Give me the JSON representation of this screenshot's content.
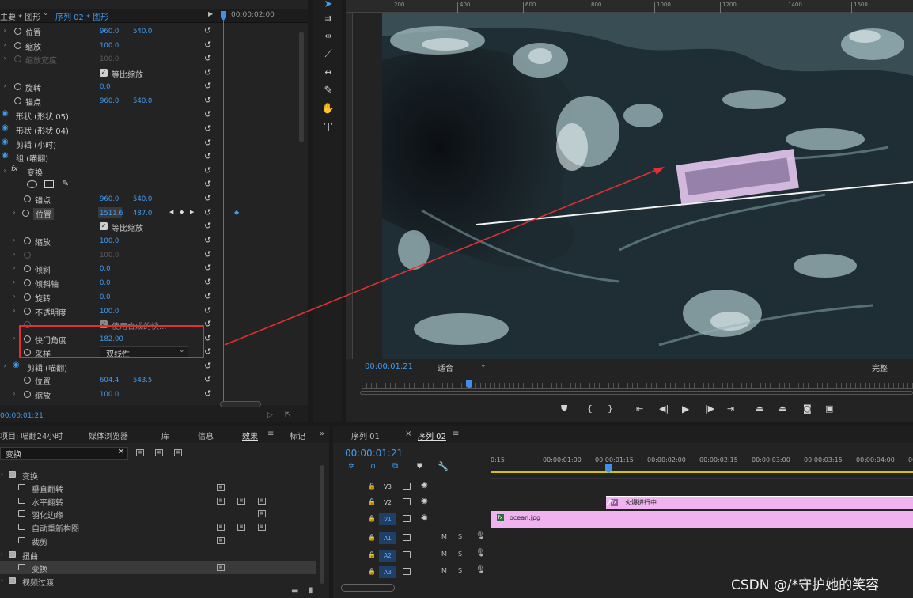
{
  "effect_controls": {
    "source_tab": "主要 * 图形",
    "sequence_tab": "序列 02 * 图形",
    "timecode_header": "00:00:02:00",
    "current_time": "00:00:01:21",
    "rows": [
      {
        "label": "位置",
        "v1": "960.0",
        "v2": "540.0"
      },
      {
        "label": "缩放",
        "v1": "100.0",
        "v2": ""
      },
      {
        "label": "缩放宽度",
        "v1": "100.0",
        "v2": ""
      },
      {
        "label": "等比缩放",
        "v1": "",
        "v2": ""
      },
      {
        "label": "旋转",
        "v1": "0.0",
        "v2": ""
      },
      {
        "label": "锚点",
        "v1": "960.0",
        "v2": "540.0"
      },
      {
        "label": "形状 (形状 05)",
        "v1": "",
        "v2": ""
      },
      {
        "label": "形状 (形状 04)",
        "v1": "",
        "v2": ""
      },
      {
        "label": "剪辑 (小时)",
        "v1": "",
        "v2": ""
      },
      {
        "label": "组 (喵翻)",
        "v1": "",
        "v2": ""
      },
      {
        "label": "变换",
        "v1": "",
        "v2": ""
      },
      {
        "label": "",
        "v1": "",
        "v2": ""
      },
      {
        "label": "锚点",
        "v1": "960.0",
        "v2": "540.0"
      },
      {
        "label": "位置",
        "v1": "1511.6",
        "v2": "487.0"
      },
      {
        "label": "等比缩放",
        "v1": "",
        "v2": ""
      },
      {
        "label": "缩放",
        "v1": "100.0",
        "v2": ""
      },
      {
        "label": "",
        "v1": "100.0",
        "v2": ""
      },
      {
        "label": "倾斜",
        "v1": "0.0",
        "v2": ""
      },
      {
        "label": "倾斜轴",
        "v1": "0.0",
        "v2": ""
      },
      {
        "label": "旋转",
        "v1": "0.0",
        "v2": ""
      },
      {
        "label": "不透明度",
        "v1": "100.0",
        "v2": ""
      },
      {
        "label": "使用合成的快...",
        "v1": "",
        "v2": ""
      },
      {
        "label": "快门角度",
        "v1": "182.00",
        "v2": ""
      },
      {
        "label": "采样",
        "v1": "",
        "v2": ""
      },
      {
        "label": "剪辑 (喵翻)",
        "v1": "",
        "v2": ""
      },
      {
        "label": "位置",
        "v1": "604.4",
        "v2": "543.5"
      },
      {
        "label": "缩放",
        "v1": "100.0",
        "v2": ""
      }
    ],
    "sampling_value": "双线性"
  },
  "program": {
    "timecode": "00:00:01:21",
    "fit": "适合",
    "quality": "完整",
    "ruler_ticks": [
      "200",
      "400",
      "600",
      "800",
      "1000",
      "1200",
      "1400",
      "1600"
    ]
  },
  "effects_panel": {
    "tabs": [
      "项目: 喵翻24小时",
      "媒体浏览器",
      "库",
      "信息",
      "效果",
      "标记"
    ],
    "search_value": "变换",
    "items": [
      {
        "label": "变换"
      },
      {
        "label": "垂直翻转"
      },
      {
        "label": "水平翻转"
      },
      {
        "label": "羽化边缘"
      },
      {
        "label": "自动重新构图"
      },
      {
        "label": "裁剪"
      },
      {
        "label": "扭曲"
      },
      {
        "label": "变换"
      },
      {
        "label": "视频过渡"
      }
    ]
  },
  "timeline": {
    "tabs": [
      "序列 01",
      "序列 02"
    ],
    "timecode": "00:00:01:21",
    "ruler": [
      "0:15",
      "00:00:01:00",
      "00:00:01:15",
      "00:00:02:00",
      "00:00:02:15",
      "00:00:03:00",
      "00:00:03:15",
      "00:00:04:00",
      "00:00:04:"
    ],
    "tracks": [
      "V3",
      "V2",
      "V1",
      "A1",
      "A2",
      "A3"
    ],
    "audio_buttons": [
      "M",
      "S"
    ],
    "clip_v2": "火爆进行中",
    "clip_v1": "ocean.jpg"
  },
  "watermark": "CSDN @/*守护她的笑容",
  "colors": {
    "accent": "#3f9cf0",
    "clip": "#f0b3f0",
    "annotation": "#e03030"
  }
}
